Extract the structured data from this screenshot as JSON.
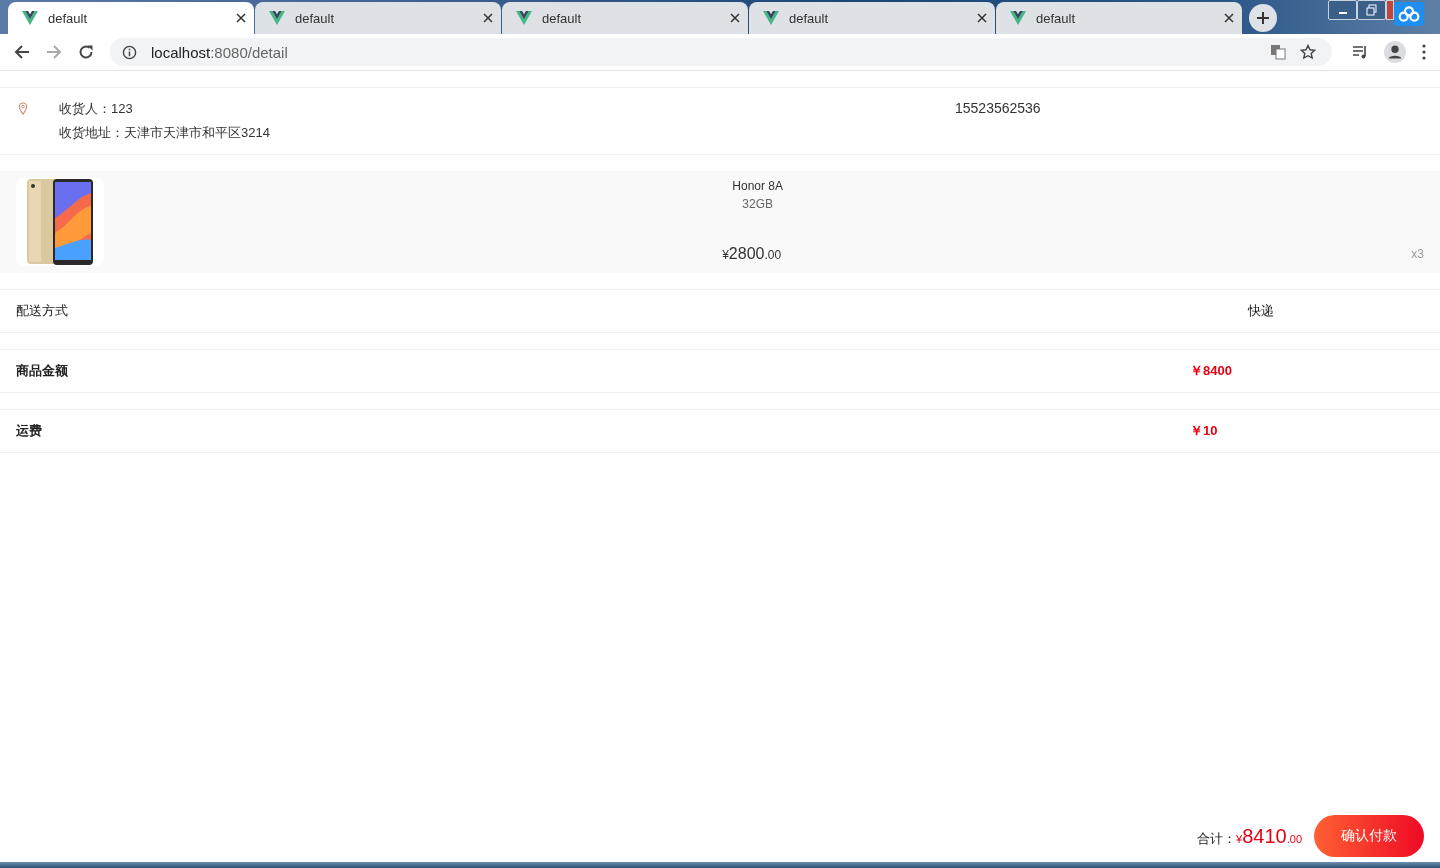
{
  "browser": {
    "tabs": [
      {
        "title": "default",
        "selected": true
      },
      {
        "title": "default",
        "selected": false
      },
      {
        "title": "default",
        "selected": false
      },
      {
        "title": "default",
        "selected": false
      },
      {
        "title": "default",
        "selected": false
      }
    ],
    "url_host": "localhost",
    "url_rest": ":8080/detail"
  },
  "shipping": {
    "recipient": "收货人：123",
    "address": "收货地址：天津市天津市和平区3214",
    "phone": "15523562536"
  },
  "product": {
    "kind": "picture",
    "name": "Honor 8A",
    "spec": "32GB",
    "currency": "¥",
    "price": "2800",
    "price_decimals": ".00",
    "quantity": "x3"
  },
  "delivery": {
    "label": "配送方式",
    "value": "快递"
  },
  "summary": [
    {
      "label": "商品金额",
      "value": "￥8400"
    },
    {
      "label": "运费",
      "value": "￥10"
    }
  ],
  "footer": {
    "total_label": "合计：",
    "currency": "¥",
    "total": "8410",
    "total_decimals": ".00",
    "button": "确认付款"
  }
}
